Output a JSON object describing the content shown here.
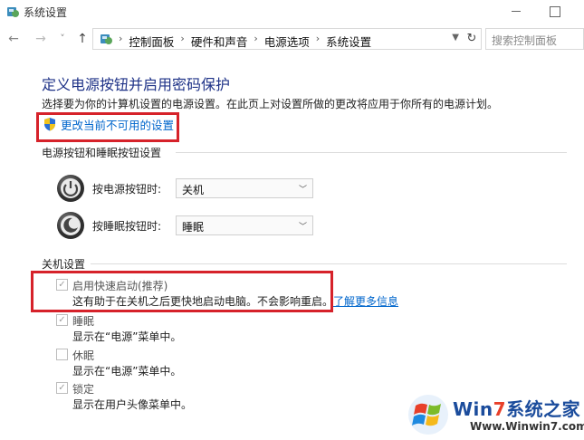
{
  "window": {
    "title": "系统设置"
  },
  "nav": {
    "back": "←",
    "forward": "→",
    "recent": "˅",
    "up": "↑",
    "breadcrumbs": [
      "控制面板",
      "硬件和声音",
      "电源选项",
      "系统设置"
    ],
    "crumb_separator": "›",
    "refresh": "↻",
    "search_placeholder": "搜索控制面板"
  },
  "main": {
    "title": "定义电源按钮并启用密码保护",
    "description": "选择要为你的计算机设置的电源设置。在此页上对设置所做的更改将应用于你所有的电源计划。",
    "change_link": "更改当前不可用的设置",
    "power_group": {
      "header": "电源按钮和睡眠按钮设置",
      "rows": [
        {
          "label": "按电源按钮时:",
          "value": "关机",
          "icon": "power-icon"
        },
        {
          "label": "按睡眠按钮时:",
          "value": "睡眠",
          "icon": "sleep-icon"
        }
      ]
    },
    "shutdown_group": {
      "header": "关机设置",
      "items": [
        {
          "title": "启用快速启动(推荐)",
          "desc": "这有助于在关机之后更快地启动电脑。不会影响重启。",
          "link": "了解更多信息",
          "checked": true
        },
        {
          "title": "睡眠",
          "desc": "显示在“电源”菜单中。",
          "checked": true
        },
        {
          "title": "休眠",
          "desc": "显示在“电源”菜单中。",
          "checked": false
        },
        {
          "title": "锁定",
          "desc": "显示在用户头像菜单中。",
          "checked": true
        }
      ]
    }
  },
  "watermark": {
    "brand_win": "Win",
    "brand_7": "7",
    "brand_rest": "系统之家",
    "url": "Www.Winwin7.com"
  },
  "colors": {
    "title_blue": "#1e3287",
    "link_blue": "#0066cc",
    "highlight_red": "#d6222a"
  }
}
